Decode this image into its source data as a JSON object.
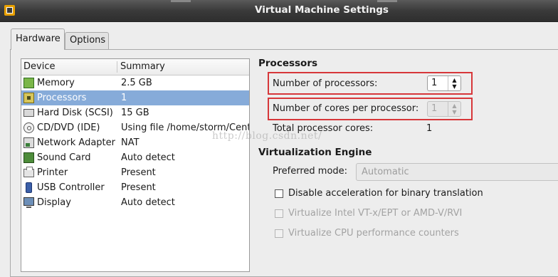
{
  "window": {
    "title": "Virtual Machine Settings"
  },
  "tabs": [
    {
      "label": "Hardware",
      "active": true
    },
    {
      "label": "Options",
      "active": false
    }
  ],
  "device_list": {
    "headers": [
      "Device",
      "Summary"
    ],
    "rows": [
      {
        "icon": "memory-icon",
        "device": "Memory",
        "summary": "2.5 GB"
      },
      {
        "icon": "processor-icon",
        "device": "Processors",
        "summary": "1",
        "selected": true
      },
      {
        "icon": "hard-disk-icon",
        "device": "Hard Disk (SCSI)",
        "summary": "15 GB"
      },
      {
        "icon": "cd-dvd-icon",
        "device": "CD/DVD (IDE)",
        "summary": "Using file /home/storm/Cent"
      },
      {
        "icon": "network-adapter-icon",
        "device": "Network Adapter",
        "summary": "NAT"
      },
      {
        "icon": "sound-card-icon",
        "device": "Sound Card",
        "summary": "Auto detect"
      },
      {
        "icon": "printer-icon",
        "device": "Printer",
        "summary": "Present"
      },
      {
        "icon": "usb-controller-icon",
        "device": "USB Controller",
        "summary": "Present"
      },
      {
        "icon": "display-icon",
        "device": "Display",
        "summary": "Auto detect"
      }
    ]
  },
  "processors": {
    "title": "Processors",
    "num_processors_label": "Number of processors:",
    "num_processors_value": "1",
    "cores_label": "Number of cores per processor:",
    "cores_value": "1",
    "total_label": "Total processor cores:",
    "total_value": "1"
  },
  "virtualization": {
    "title": "Virtualization Engine",
    "mode_label": "Preferred mode:",
    "mode_value": "Automatic",
    "options": [
      {
        "label": "Disable acceleration for binary translation",
        "enabled": true,
        "checked": false
      },
      {
        "label": "Virtualize Intel VT-x/EPT or AMD-V/RVI",
        "enabled": false,
        "checked": false
      },
      {
        "label": "Virtualize CPU performance counters",
        "enabled": false,
        "checked": false
      }
    ]
  },
  "watermark": "http://blog.csdn.net/",
  "colors": {
    "selection": "#86abd9",
    "highlight_box": "#d7373a",
    "titlebar": "#3a3a3a"
  }
}
